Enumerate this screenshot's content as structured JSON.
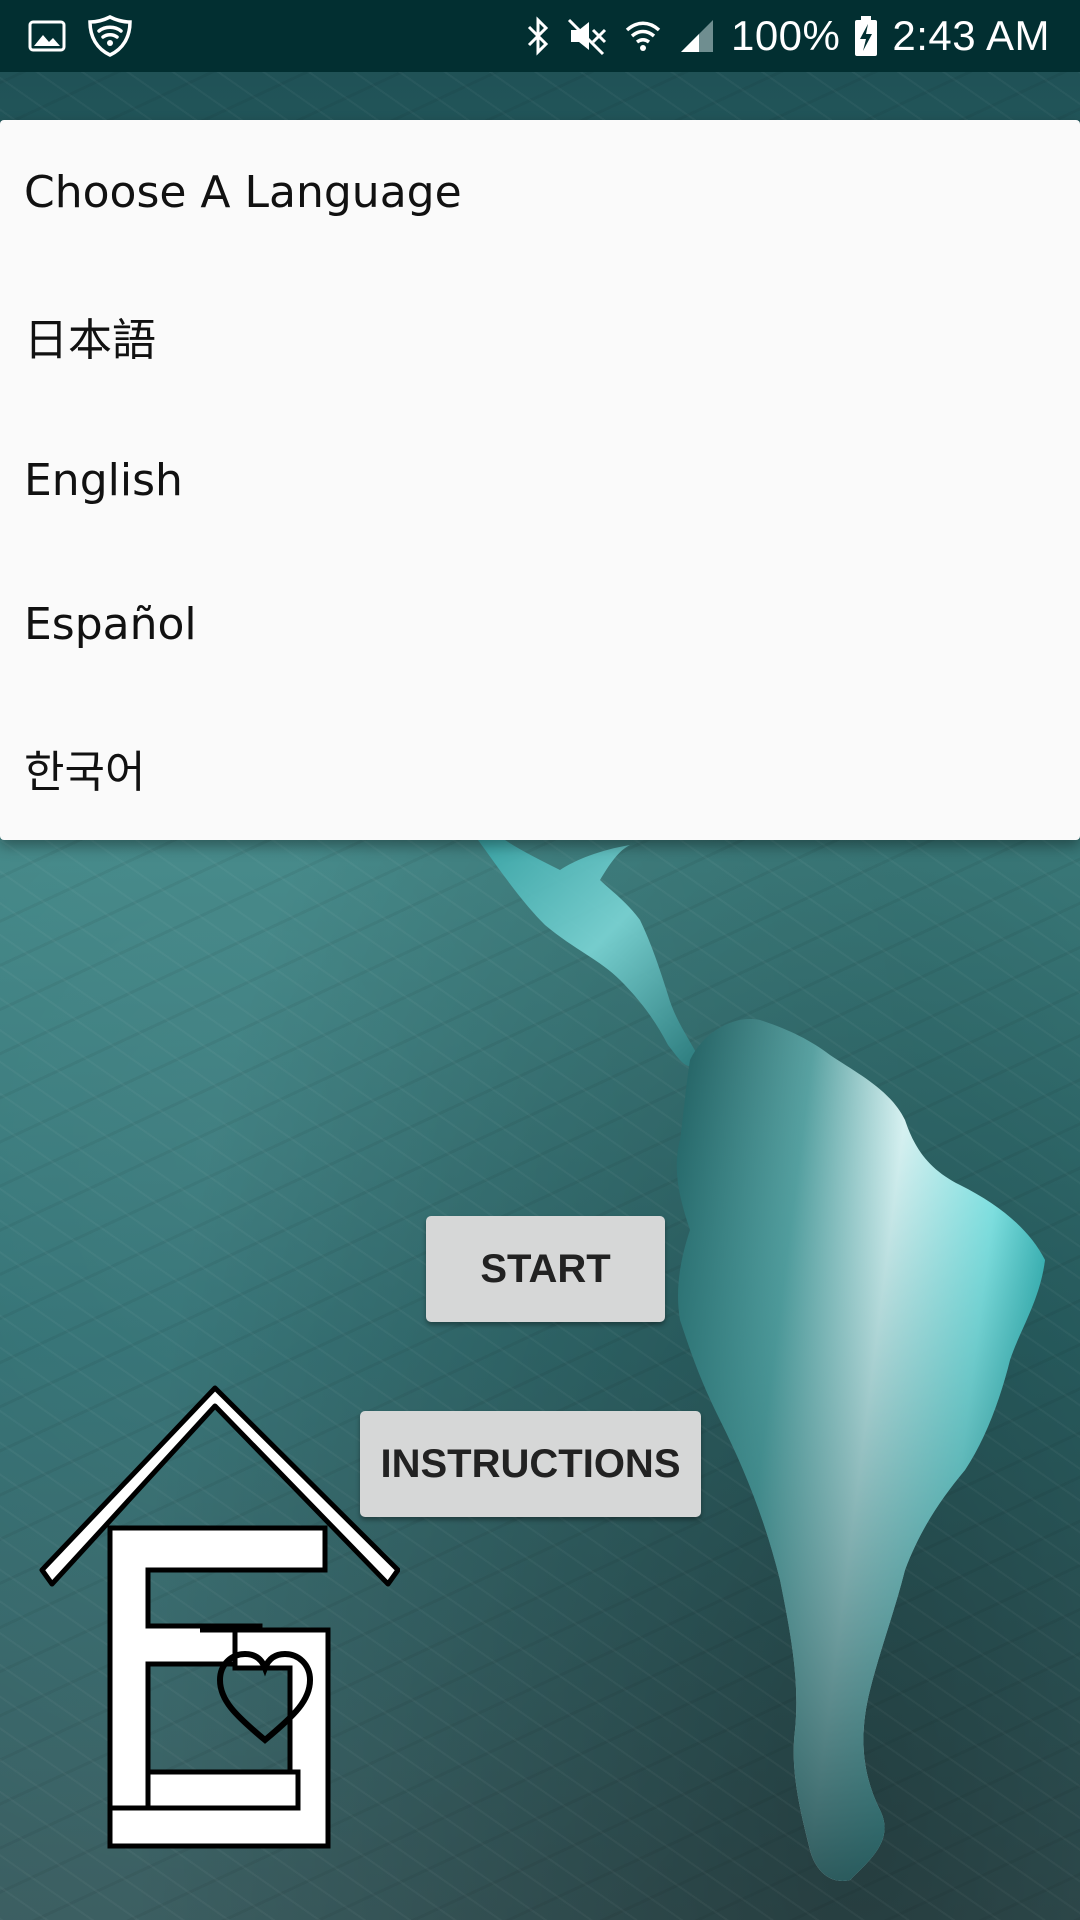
{
  "status_bar": {
    "battery": "100%",
    "time": "2:43 AM",
    "icons_left": [
      "image-icon",
      "shield-wifi-icon"
    ],
    "icons_right": [
      "bluetooth-icon",
      "mute-icon",
      "wifi-icon",
      "signal-icon",
      "battery-charging-icon"
    ]
  },
  "menu": {
    "items": [
      {
        "label": "Choose A Language"
      },
      {
        "label": "日本語"
      },
      {
        "label": "English"
      },
      {
        "label": "Español"
      },
      {
        "label": "한국어"
      }
    ]
  },
  "buttons": {
    "start": "START",
    "instructions": "INSTRUCTIONS"
  },
  "colors": {
    "status_bar": "#022f31",
    "menu_background": "#fafafa",
    "button_background": "#d6d7d7",
    "background_teal": "#3f8585"
  }
}
